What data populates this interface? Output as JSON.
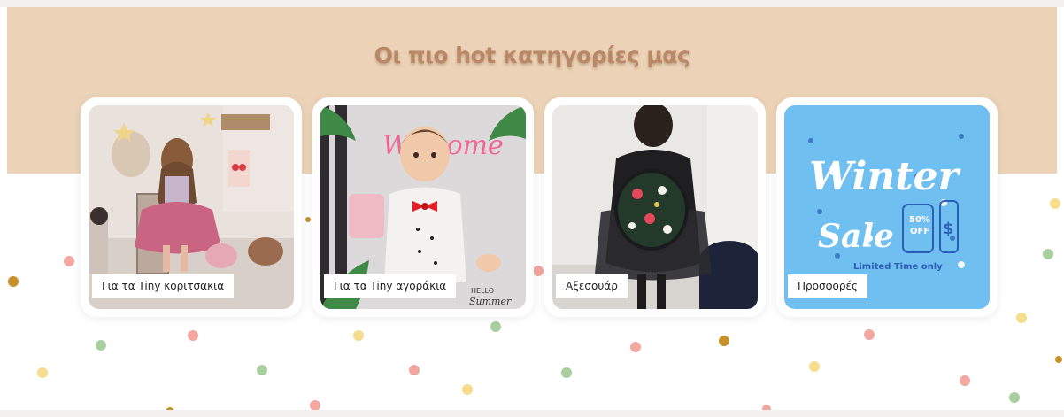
{
  "section": {
    "heading": "Οι πιο hot κατηγορίες μας"
  },
  "categories": [
    {
      "label": "Για τα Tiny κοριτσακια",
      "image_icon": "girl-in-tutu-photo"
    },
    {
      "label": "Για τα Tiny αγοράκια",
      "image_icon": "boy-in-bowtie-photo"
    },
    {
      "label": "Αξεσουάρ",
      "image_icon": "kid-backpack-photo"
    },
    {
      "label": "Προσφορές",
      "image_icon": "winter-sale-graphic"
    }
  ],
  "promo_art": {
    "line1": "Winter",
    "line2": "Sale",
    "line3": "Limited Time only",
    "tag1_top": "50%",
    "tag1_bottom": "OFF",
    "tag2": "$"
  },
  "photo_text": {
    "neon": "Welcome",
    "hello": "HELLO",
    "summer": "Summer"
  },
  "colors": {
    "band": "#ecd3b7",
    "heading": "#b98866",
    "promo_bg": "#6fbff0",
    "dot_pink": "#f2a7a0",
    "dot_yellow": "#f6dd8e",
    "dot_green": "#a9cf9f",
    "dot_mustard": "#c8922a"
  }
}
